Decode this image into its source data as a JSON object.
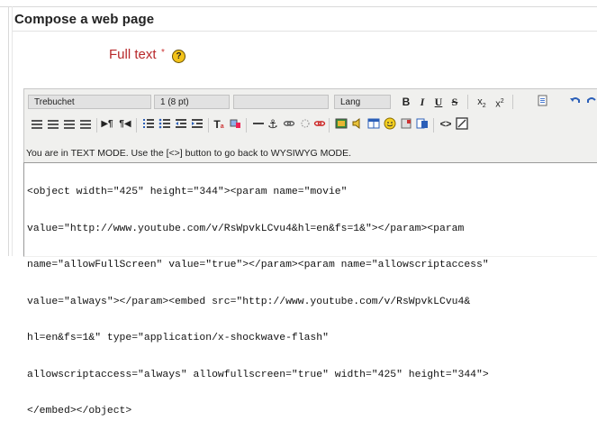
{
  "form": {
    "legend": "Compose a web page",
    "field_label": "Full text",
    "required_marker": "*",
    "help_glyph": "?"
  },
  "toolbar": {
    "font_family": "Trebuchet",
    "font_size": "1 (8 pt)",
    "paragraph_style": "",
    "language": "Lang",
    "bold_label": "B",
    "italic_label": "I",
    "underline_label": "U",
    "strike_label": "S",
    "subscript_label": "x",
    "superscript_label": "x",
    "html_toggle_label": "<>",
    "icons_row1": [
      "copy-icon",
      "undo-icon",
      "redo-icon"
    ],
    "icons_row2": [
      "align-left-icon",
      "align-center-icon",
      "align-right-icon",
      "justify-icon",
      "ltr-icon",
      "rtl-icon",
      "numbered-list-icon",
      "bullet-list-icon",
      "outdent-icon",
      "indent-icon",
      "text-color-icon",
      "background-color-icon",
      "horizontal-rule-icon",
      "anchor-icon",
      "link-icon",
      "unlink-icon",
      "no-link-icon",
      "image-icon",
      "media-icon",
      "table-icon",
      "smiley-icon",
      "special-char-icon",
      "search-replace-icon",
      "html-mode-icon",
      "fullscreen-icon"
    ]
  },
  "editor": {
    "mode_notice": "You are in TEXT MODE. Use the [<>] button to go back to WYSIWYG MODE.",
    "code_lines": [
      "<object width=\"425\" height=\"344\"><param name=\"movie\"",
      "value=\"http://www.youtube.com/v/RsWpvkLCvu4&hl=en&fs=1&\"></param><param",
      "name=\"allowFullScreen\" value=\"true\"></param><param name=\"allowscriptaccess\"",
      "value=\"always\"></param><embed src=\"http://www.youtube.com/v/RsWpvkLCvu4&",
      "hl=en&fs=1&\" type=\"application/x-shockwave-flash\"",
      "allowscriptaccess=\"always\" allowfullscreen=\"true\" width=\"425\" height=\"344\">",
      "</embed></object>"
    ]
  }
}
